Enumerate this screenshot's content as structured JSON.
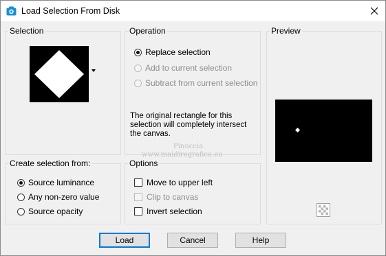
{
  "window": {
    "title": "Load Selection From Disk"
  },
  "selection_group": {
    "title": "Selection"
  },
  "operation_group": {
    "title": "Operation",
    "options": [
      {
        "label": "Replace selection",
        "checked": true,
        "enabled": true
      },
      {
        "label": "Add to current selection",
        "checked": false,
        "enabled": false
      },
      {
        "label": "Subtract from current selection",
        "checked": false,
        "enabled": false
      }
    ],
    "info": "The original rectangle for this selection will completely intersect the canvas."
  },
  "preview_group": {
    "title": "Preview"
  },
  "create_group": {
    "title": "Create selection from:",
    "options": [
      {
        "label": "Source luminance",
        "checked": true
      },
      {
        "label": "Any non-zero value",
        "checked": false
      },
      {
        "label": "Source opacity",
        "checked": false
      }
    ]
  },
  "options_group": {
    "title": "Options",
    "items": [
      {
        "label": "Move to upper left",
        "checked": false,
        "enabled": true
      },
      {
        "label": "Clip to canvas",
        "checked": false,
        "enabled": false
      },
      {
        "label": "Invert selection",
        "checked": false,
        "enabled": true
      }
    ]
  },
  "buttons": {
    "load": "Load",
    "cancel": "Cancel",
    "help": "Help"
  },
  "watermark": {
    "line1": "Pinuccia",
    "line2": "www.maidiregrafica.eu"
  },
  "colors": {
    "accent": "#0078d7",
    "titlebar_icon": "#1a8fd6"
  }
}
